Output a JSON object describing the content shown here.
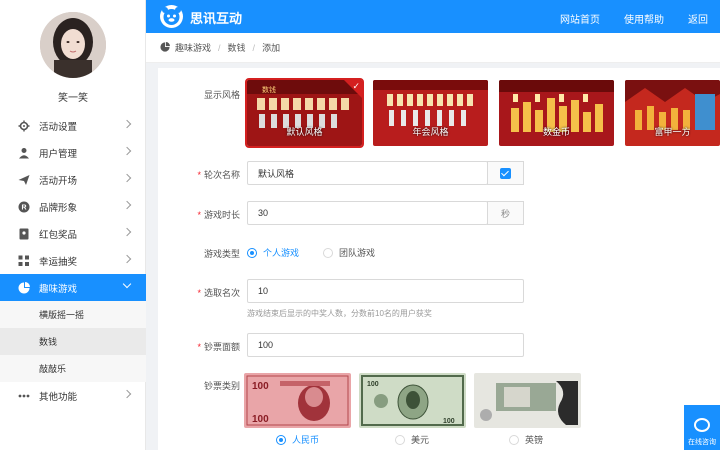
{
  "user": {
    "name": "笑一笑"
  },
  "sidebar": {
    "items": [
      {
        "label": "活动设置",
        "icon": "gear-icon"
      },
      {
        "label": "用户管理",
        "icon": "user-icon"
      },
      {
        "label": "活动开场",
        "icon": "send-icon"
      },
      {
        "label": "品牌形象",
        "icon": "registered-icon"
      },
      {
        "label": "红包奖品",
        "icon": "redpacket-icon"
      },
      {
        "label": "幸运抽奖",
        "icon": "grid-icon"
      },
      {
        "label": "趣味游戏",
        "icon": "game-icon",
        "active": true
      },
      {
        "label": "其他功能",
        "icon": "more-icon"
      }
    ],
    "subitems": [
      {
        "label": "横版摇一摇"
      },
      {
        "label": "数钱",
        "selected": true
      },
      {
        "label": "敲敲乐"
      }
    ]
  },
  "topbar": {
    "brand": "思讯互动",
    "nav": [
      "网站首页",
      "使用帮助",
      "返回"
    ]
  },
  "breadcrumb": [
    "趣味游戏",
    "数钱",
    "添加"
  ],
  "form": {
    "style_label": "显示风格",
    "styles": [
      "默认风格",
      "年会风格",
      "数金币",
      "富甲一方"
    ],
    "round_label": "轮次名称",
    "round_value": "默认风格",
    "duration_label": "游戏时长",
    "duration_value": "30",
    "duration_unit": "秒",
    "type_label": "游戏类型",
    "type_options": [
      "个人游戏",
      "团队游戏"
    ],
    "rank_label": "选取名次",
    "rank_value": "10",
    "rank_hint": "游戏结束后显示的中奖人数，分数前10名的用户获奖",
    "denom_label": "钞票面额",
    "denom_value": "100",
    "currency_label": "钞票类别",
    "currencies": [
      "人民币",
      "美元",
      "英镑"
    ]
  },
  "chat": {
    "label": "在线咨询"
  },
  "colors": {
    "accent": "#1890ff",
    "danger": "#d42020"
  }
}
